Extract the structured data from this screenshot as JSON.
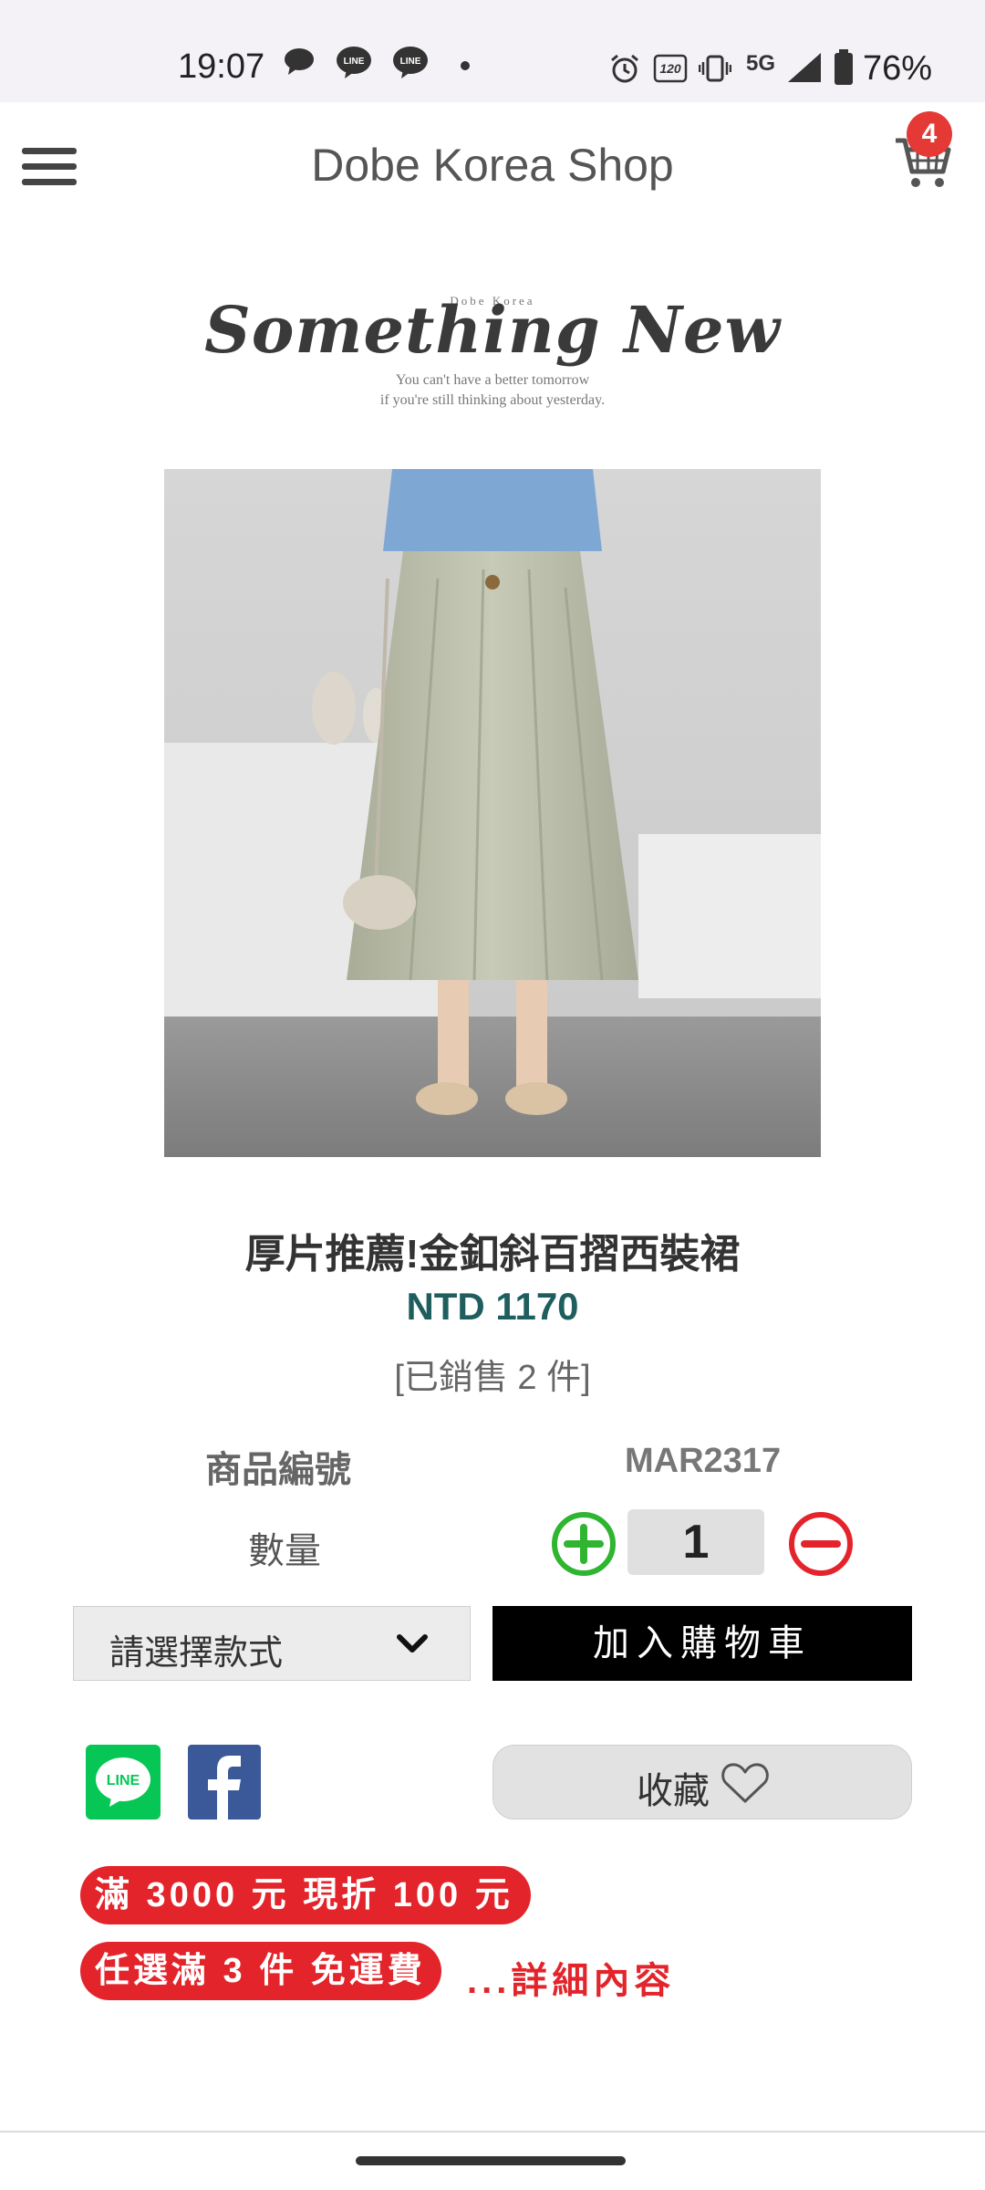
{
  "status_bar": {
    "time": "19:07",
    "network": "5G",
    "battery": "76%",
    "icons": [
      "chat-icon",
      "line-icon",
      "line-icon",
      "dot-icon",
      "alarm-icon",
      "refresh-rate-icon",
      "vibrate-icon",
      "signal-icon",
      "battery-icon"
    ]
  },
  "header": {
    "title": "Dobe Korea Shop",
    "cart_count": "4"
  },
  "banner": {
    "small_text": "Dobe Korea",
    "script_text": "Something New",
    "subtitle_line1": "You can't have a better tomorrow",
    "subtitle_line2": "if you're still thinking about yesterday."
  },
  "product": {
    "title": "厚片推薦!金釦斜百摺西裝裙",
    "price": "NTD 1170",
    "sold": "[已銷售 2 件]",
    "sku_label": "商品編號",
    "sku_value": "MAR2317",
    "qty_label": "數量",
    "qty_value": "1"
  },
  "actions": {
    "style_select": "請選擇款式",
    "add_to_cart": "加入購物車",
    "favorite": "收藏"
  },
  "promos": {
    "promo1": "滿 3000 元 現折 100 元",
    "promo2": "任選滿 3 件 免運費",
    "detail": "...詳細內容"
  },
  "colors": {
    "accent_red": "#e3242b",
    "price_teal": "#1e5e5e",
    "line_green": "#06c755",
    "facebook_blue": "#3b5998"
  }
}
